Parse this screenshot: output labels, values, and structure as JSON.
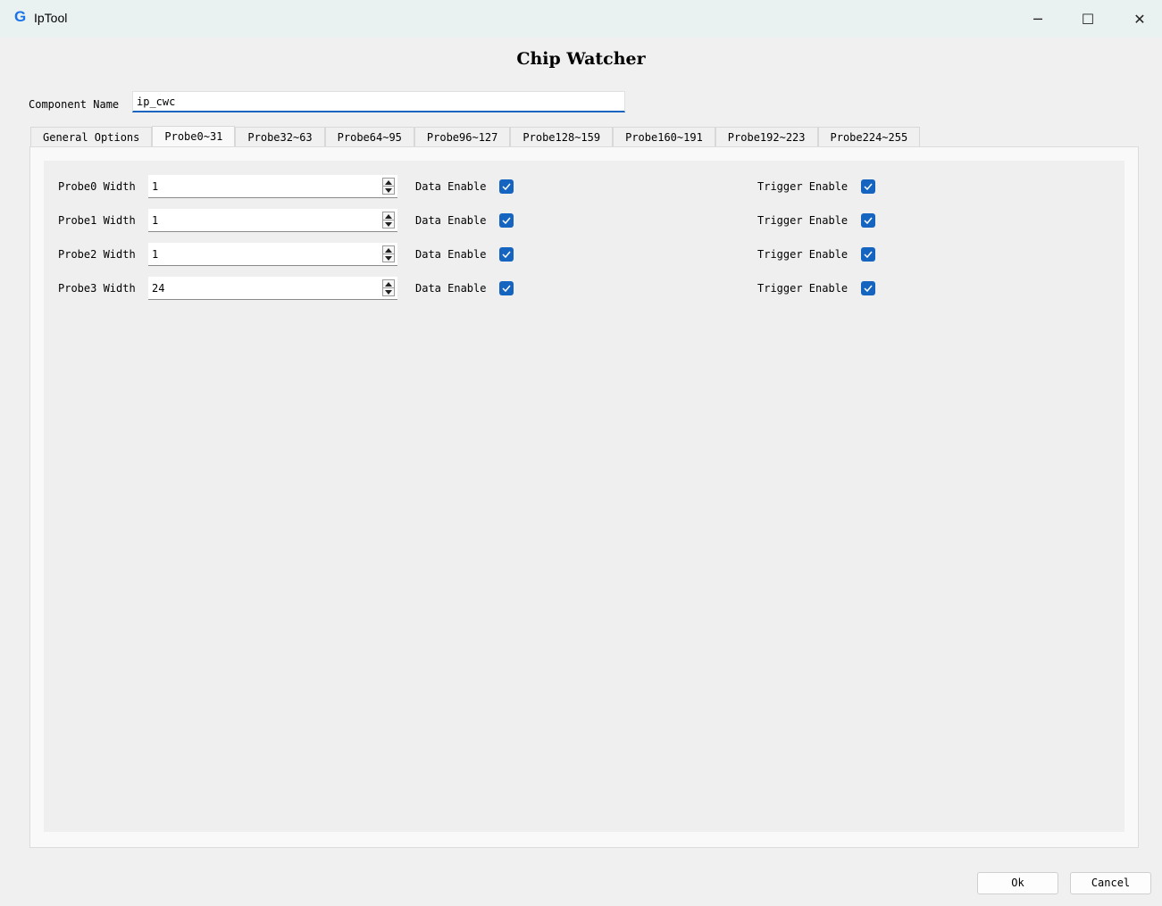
{
  "window": {
    "app_icon": "G",
    "title": "IpTool",
    "minimize_glyph": "─",
    "maximize_glyph": "☐",
    "close_glyph": "✕"
  },
  "heading": "Chip Watcher",
  "component": {
    "label": "Component Name",
    "value": "ip_cwc"
  },
  "tabs": [
    {
      "label": "General Options",
      "active": false
    },
    {
      "label": "Probe0~31",
      "active": true
    },
    {
      "label": "Probe32~63",
      "active": false
    },
    {
      "label": "Probe64~95",
      "active": false
    },
    {
      "label": "Probe96~127",
      "active": false
    },
    {
      "label": "Probe128~159",
      "active": false
    },
    {
      "label": "Probe160~191",
      "active": false
    },
    {
      "label": "Probe192~223",
      "active": false
    },
    {
      "label": "Probe224~255",
      "active": false
    }
  ],
  "probes": [
    {
      "label": "Probe0 Width",
      "width": "1",
      "data_enable_label": "Data Enable",
      "data_enable": true,
      "trigger_enable_label": "Trigger Enable",
      "trigger_enable": true
    },
    {
      "label": "Probe1 Width",
      "width": "1",
      "data_enable_label": "Data Enable",
      "data_enable": true,
      "trigger_enable_label": "Trigger Enable",
      "trigger_enable": true
    },
    {
      "label": "Probe2 Width",
      "width": "1",
      "data_enable_label": "Data Enable",
      "data_enable": true,
      "trigger_enable_label": "Trigger Enable",
      "trigger_enable": true
    },
    {
      "label": "Probe3 Width",
      "width": "24",
      "data_enable_label": "Data Enable",
      "data_enable": true,
      "trigger_enable_label": "Trigger Enable",
      "trigger_enable": true
    }
  ],
  "buttons": {
    "ok": "Ok",
    "cancel": "Cancel"
  },
  "colors": {
    "accent": "#1565c0",
    "titlebar_bg": "#eaf2f1",
    "window_bg": "#f0f0f0"
  },
  "icons": {
    "app": "g-logo-icon",
    "minimize": "minimize-icon",
    "maximize": "maximize-icon",
    "close": "close-icon",
    "checkbox": "checkmark-icon",
    "spin_up": "caret-up-icon",
    "spin_down": "caret-down-icon"
  }
}
